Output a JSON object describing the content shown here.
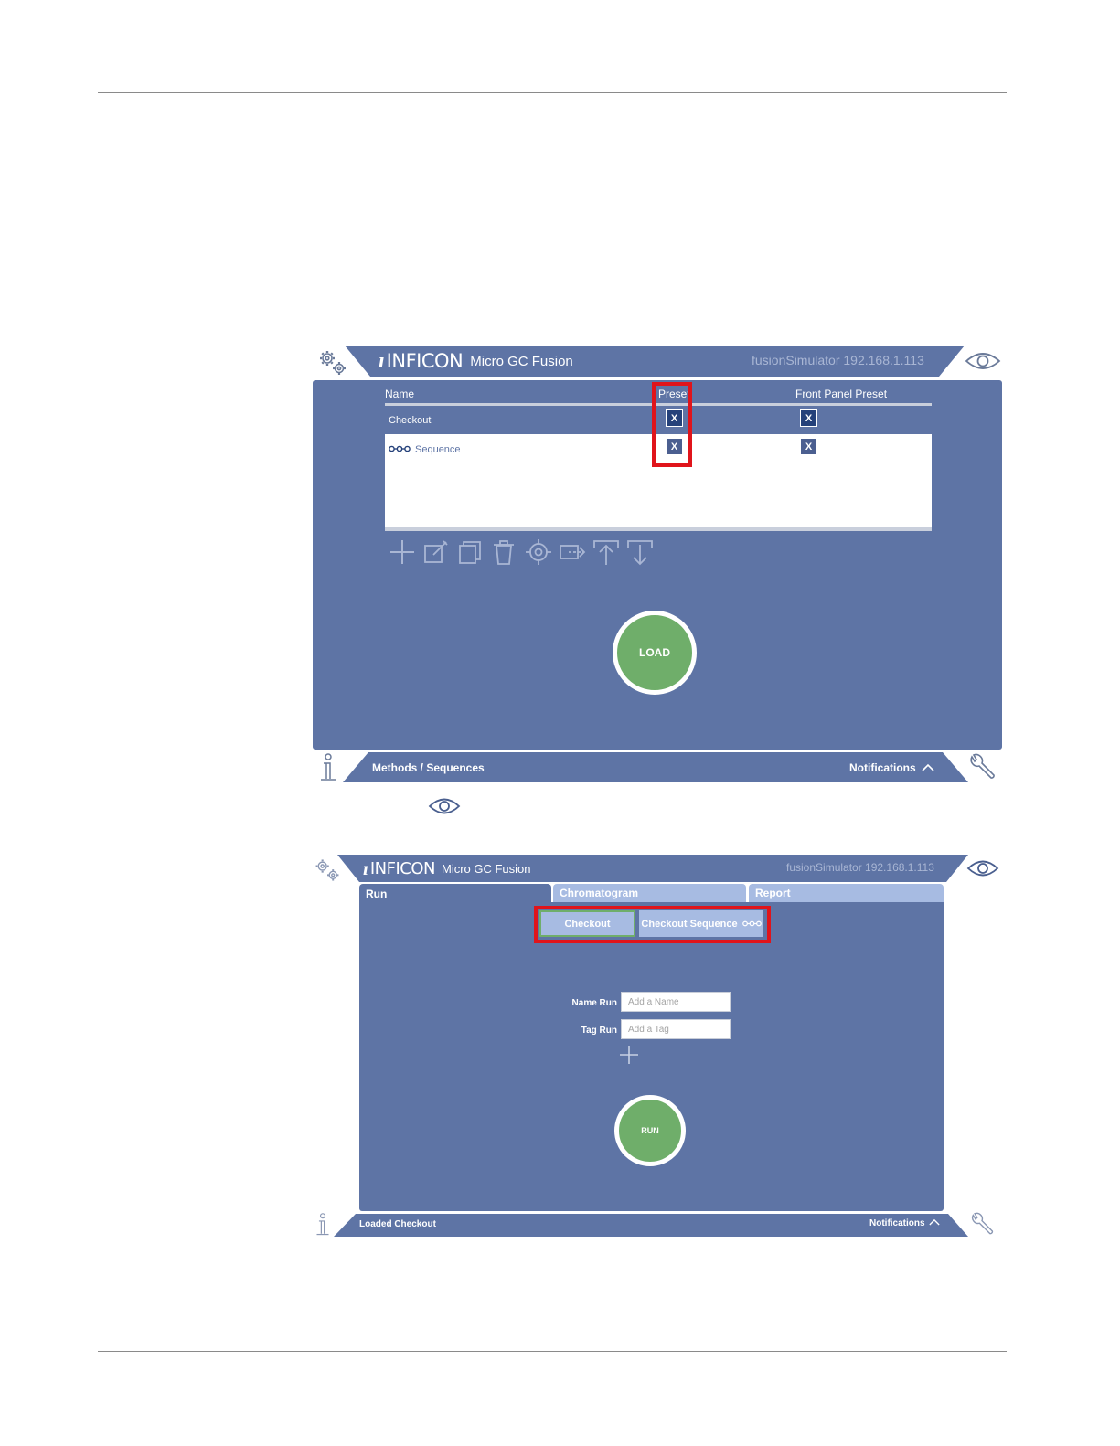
{
  "screen1": {
    "brand": {
      "logo_mark": "ı",
      "logo_text": "INFICON",
      "product": "Micro GC Fusion"
    },
    "host": "fusionSimulator 192.168.1.113",
    "table": {
      "col_name": "Name",
      "col_preset": "Preset",
      "col_front_panel": "Front Panel Preset",
      "rows": [
        {
          "name": "Checkout",
          "preset": "X",
          "front_panel": "X",
          "selected": true
        },
        {
          "name": "Sequence",
          "icon": "sequence-icon",
          "preset": "X",
          "front_panel": "X",
          "selected": false
        }
      ]
    },
    "toolbar": [
      "add-icon",
      "edit-icon",
      "copy-icon",
      "delete-icon",
      "target-icon",
      "import-icon",
      "upload-icon",
      "download-icon"
    ],
    "load_label": "LOAD",
    "footer": {
      "left": "Methods / Sequences",
      "right": "Notifications"
    }
  },
  "eye_caption_icon": "eye-icon",
  "screen2": {
    "brand": {
      "logo_mark": "ı",
      "logo_text": "INFICON",
      "product": "Micro GC Fusion"
    },
    "host": "fusionSimulator 192.168.1.113",
    "tabs": [
      {
        "label": "Run",
        "active": true
      },
      {
        "label": "Chromatogram",
        "active": false
      },
      {
        "label": "Report",
        "active": false
      }
    ],
    "methods": {
      "first": "Checkout",
      "second": "Checkout Sequence"
    },
    "name_run": {
      "label": "Name Run",
      "placeholder": "Add a Name"
    },
    "tag_run": {
      "label": "Tag Run",
      "placeholder": "Add a Tag"
    },
    "run_label": "RUN",
    "footer": {
      "left": "Loaded Checkout",
      "right": "Notifications"
    }
  },
  "colors": {
    "panel": "#5e74a5",
    "selected_row": "#5e74a5",
    "x_button": "#25417a",
    "highlight": "#e0141b",
    "run_green": "#6fae6a",
    "tab_inactive": "#a7bbe2"
  }
}
